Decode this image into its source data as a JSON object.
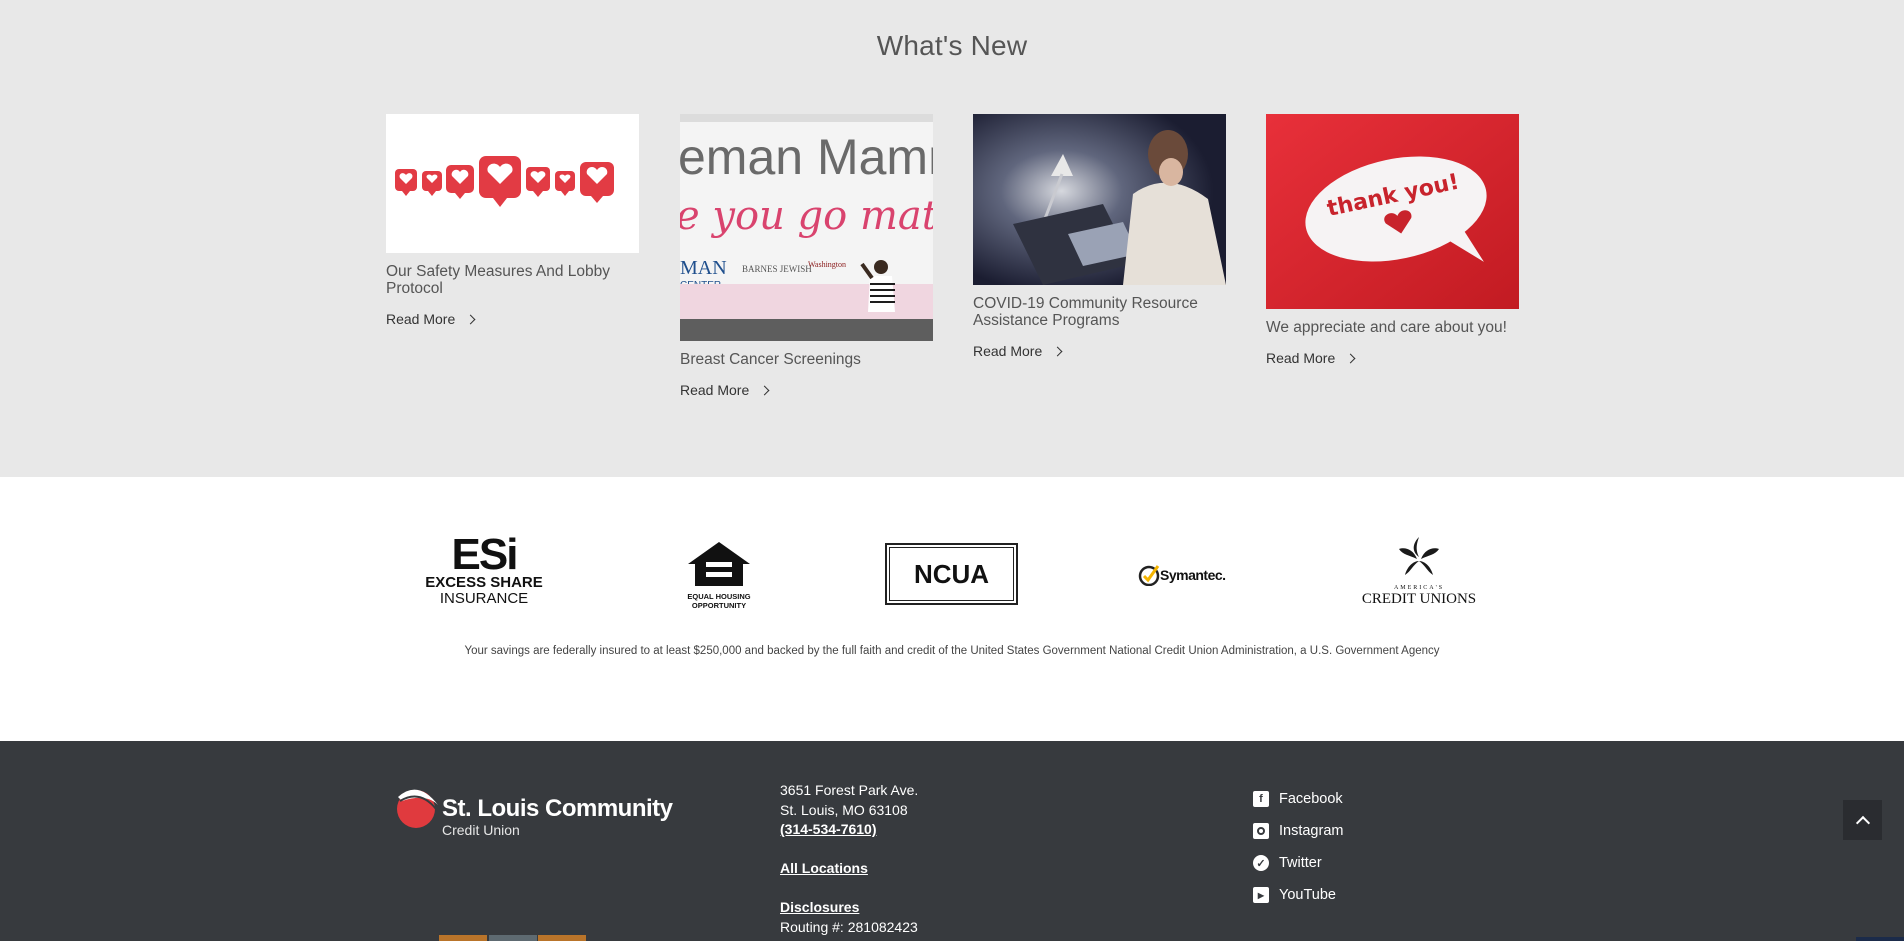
{
  "news": {
    "title": "What's New",
    "cards": [
      {
        "title": "Our Safety Measures And Lobby Protocol",
        "read_more": "Read More"
      },
      {
        "title": "Breast Cancer Screenings",
        "read_more": "Read More",
        "image_text": "eman Mamm",
        "image_script": "e you go matter"
      },
      {
        "title": "COVID-19 Community Resource Assistance Programs",
        "read_more": "Read More"
      },
      {
        "title": "We appreciate and care about you!",
        "read_more": "Read More",
        "bubble_text": "thank you!"
      }
    ]
  },
  "logos": {
    "esi_big": "ESi",
    "esi_line1": "EXCESS SHARE",
    "esi_line2": "INSURANCE",
    "housing_line1": "EQUAL HOUSING",
    "housing_line2": "OPPORTUNITY",
    "ncua": "NCUA",
    "symantec": "Symantec.",
    "acu_small": "AMERICA'S",
    "acu_big": "CREDIT UNIONS",
    "disclaimer": "Your savings are federally insured to at least $250,000 and backed by the full faith and credit of the United States Government National Credit Union Administration, a U.S. Government Agency"
  },
  "footer": {
    "brand_name": "St. Louis Community",
    "brand_sub": "Credit Union",
    "address_line1": "3651 Forest Park Ave.",
    "address_line2": "St. Louis, MO 63108",
    "phone": "(314-534-7610)",
    "all_locations": "All Locations",
    "disclosures": "Disclosures",
    "routing": "Routing #: 281082423",
    "social": [
      "Facebook",
      "Instagram",
      "Twitter",
      "YouTube"
    ]
  },
  "colors": {
    "accent_red": "#e03a3e",
    "footer_bg": "#373a3e",
    "swatch_orange": "#b9742a",
    "swatch_gray": "#5e6a71"
  }
}
